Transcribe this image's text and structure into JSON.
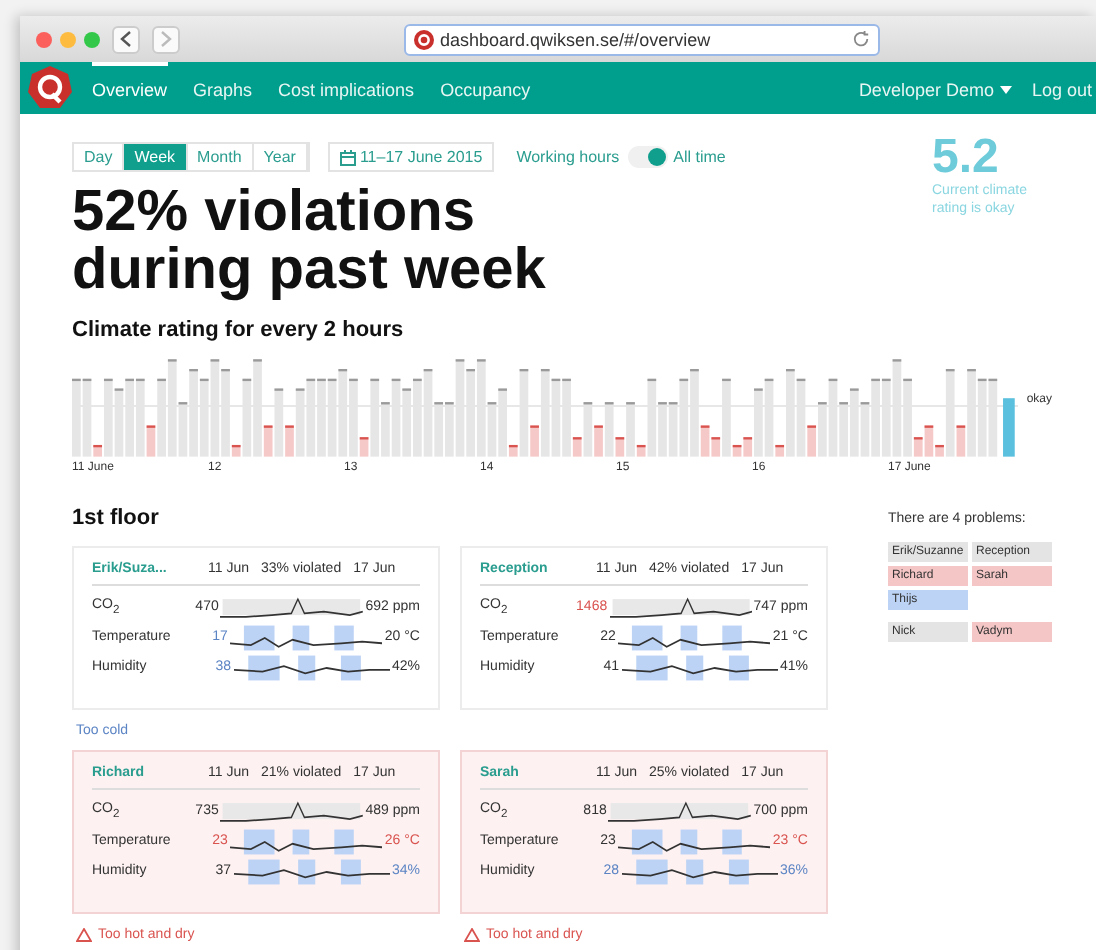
{
  "browser": {
    "url": "dashboard.qwiksen.se/#/overview"
  },
  "nav": {
    "items": [
      {
        "label": "Overview",
        "selected": true
      },
      {
        "label": "Graphs",
        "selected": false
      },
      {
        "label": "Cost implications",
        "selected": false
      },
      {
        "label": "Occupancy",
        "selected": false
      }
    ],
    "account": "Developer Demo",
    "logout": "Log out"
  },
  "periods": [
    {
      "label": "Day",
      "selected": false
    },
    {
      "label": "Week",
      "selected": true
    },
    {
      "label": "Month",
      "selected": false
    },
    {
      "label": "Year",
      "selected": false
    }
  ],
  "date_range": "11–17 June 2015",
  "toggle": {
    "left": "Working hours",
    "right": "All time",
    "on": true
  },
  "rating": {
    "value": "5.2",
    "caption": "Current climate rating is okay"
  },
  "headline": "52% violations during past week",
  "chart": {
    "title": "Climate rating for every 2 hours",
    "x_labels": [
      "11 June",
      "12",
      "13",
      "14",
      "15",
      "16",
      "17 June"
    ],
    "threshold_label": "okay"
  },
  "floor": {
    "title": "1st floor",
    "cards": [
      {
        "name": "Erik/Suza...",
        "start": "11 Jun",
        "violated": "33% violated",
        "end": "17 Jun",
        "alert": false,
        "rows": [
          {
            "label": "CO$_{2}$",
            "from": {
              "text": "470",
              "kind": "normal"
            },
            "to": {
              "text": "692 ppm",
              "kind": "normal"
            }
          },
          {
            "label": "Temperature",
            "from": {
              "text": "17",
              "kind": "cold"
            },
            "to": {
              "text": "20 °C",
              "kind": "normal"
            }
          },
          {
            "label": "Humidity",
            "from": {
              "text": "38",
              "kind": "cold"
            },
            "to": {
              "text": "42%",
              "kind": "normal"
            }
          }
        ],
        "note": {
          "text": "Too cold",
          "kind": "cold",
          "warning": false
        }
      },
      {
        "name": "Reception",
        "start": "11 Jun",
        "violated": "42% violated",
        "end": "17 Jun",
        "alert": false,
        "rows": [
          {
            "label": "CO$_{2}$",
            "from": {
              "text": "1468",
              "kind": "hot"
            },
            "to": {
              "text": "747 ppm",
              "kind": "normal"
            }
          },
          {
            "label": "Temperature",
            "from": {
              "text": "22",
              "kind": "normal"
            },
            "to": {
              "text": "21 °C",
              "kind": "normal"
            }
          },
          {
            "label": "Humidity",
            "from": {
              "text": "41",
              "kind": "normal"
            },
            "to": {
              "text": "41%",
              "kind": "normal"
            }
          }
        ]
      },
      {
        "name": "Richard",
        "start": "11 Jun",
        "violated": "21% violated",
        "end": "17 Jun",
        "alert": true,
        "rows": [
          {
            "label": "CO$_{2}$",
            "from": {
              "text": "735",
              "kind": "normal"
            },
            "to": {
              "text": "489 ppm",
              "kind": "normal"
            }
          },
          {
            "label": "Temperature",
            "from": {
              "text": "23",
              "kind": "hot"
            },
            "to": {
              "text": "26 °C",
              "kind": "hot"
            }
          },
          {
            "label": "Humidity",
            "from": {
              "text": "37",
              "kind": "normal"
            },
            "to": {
              "text": "34%",
              "kind": "cold"
            }
          }
        ],
        "note": {
          "text": "Too hot and dry",
          "kind": "hot",
          "warning": true
        }
      },
      {
        "name": "Sarah",
        "start": "11 Jun",
        "violated": "25% violated",
        "end": "17 Jun",
        "alert": true,
        "rows": [
          {
            "label": "CO$_{2}$",
            "from": {
              "text": "818",
              "kind": "normal"
            },
            "to": {
              "text": "700 ppm",
              "kind": "normal"
            }
          },
          {
            "label": "Temperature",
            "from": {
              "text": "23",
              "kind": "normal"
            },
            "to": {
              "text": "23 °C",
              "kind": "hot"
            }
          },
          {
            "label": "Humidity",
            "from": {
              "text": "28",
              "kind": "cold"
            },
            "to": {
              "text": "36%",
              "kind": "cold"
            }
          }
        ],
        "note": {
          "text": "Too hot and dry",
          "kind": "hot",
          "warning": true
        }
      }
    ]
  },
  "problems": {
    "title": "There are 4 problems:",
    "groups": [
      {
        "items": [
          {
            "name": "Erik/Suzanne",
            "color": "#e4e4e4"
          },
          {
            "name": "Reception",
            "color": "#e4e4e4"
          },
          {
            "name": "Richard",
            "color": "#f5c6c6"
          },
          {
            "name": "Sarah",
            "color": "#f5c6c6"
          },
          {
            "name": "Thijs",
            "color": "#bcd3f5"
          }
        ]
      },
      {
        "items": [
          {
            "name": "Nick",
            "color": "#e4e4e4"
          },
          {
            "name": "Vadym",
            "color": "#f5c6c6"
          }
        ]
      }
    ]
  }
}
